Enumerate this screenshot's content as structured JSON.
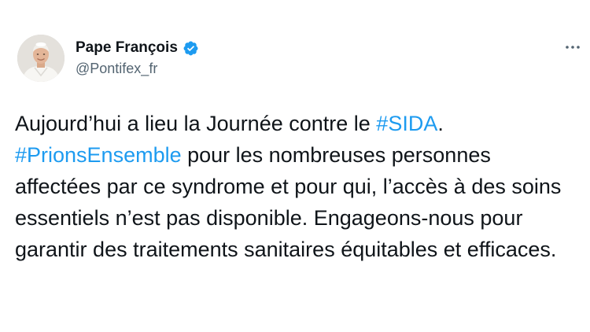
{
  "author": {
    "name": "Pape François",
    "handle": "@Pontifex_fr",
    "verified": true,
    "verified_badge_color": "#1d9bf0",
    "avatar_icon": "avatar-portrait"
  },
  "more_menu_icon": "more-icon",
  "tweet": {
    "seg1": "Aujourd’hui a lieu la Journée contre le ",
    "hashtag1": "#SIDA",
    "seg2": ". ",
    "hashtag2": "#PrionsEnsemble",
    "seg3": " pour les nombreuses personnes affectées par ce syndrome et pour qui, l’accès à des soins essentiels n’est pas disponible. Engageons-nous pour garantir des traitements sanitaires équitables et efficaces."
  },
  "colors": {
    "text": "#0f1419",
    "secondary": "#536471",
    "link": "#1d9bf0"
  }
}
